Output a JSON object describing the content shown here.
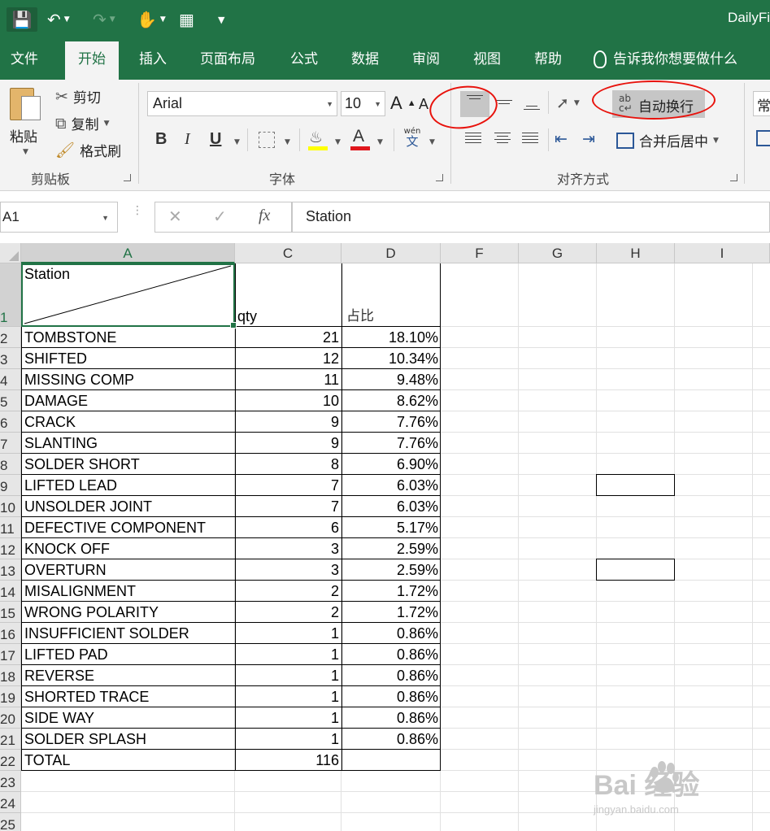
{
  "title_bar": {
    "app_title": "DailyFi"
  },
  "tabs": [
    {
      "id": "file",
      "label": "文件"
    },
    {
      "id": "home",
      "label": "开始",
      "active": true
    },
    {
      "id": "insert",
      "label": "插入"
    },
    {
      "id": "layout",
      "label": "页面布局"
    },
    {
      "id": "formulas",
      "label": "公式"
    },
    {
      "id": "data",
      "label": "数据"
    },
    {
      "id": "review",
      "label": "审阅"
    },
    {
      "id": "view",
      "label": "视图"
    },
    {
      "id": "help",
      "label": "帮助"
    }
  ],
  "tell_me": {
    "label": "告诉我你想要做什么"
  },
  "ribbon": {
    "clipboard": {
      "paste": "粘贴",
      "cut": "剪切",
      "copy": "复制",
      "painter": "格式刷",
      "group": "剪贴板"
    },
    "font": {
      "name": "Arial",
      "size": "10",
      "bold": "B",
      "italic": "I",
      "underline": "U",
      "phonetic": "wén",
      "phonetic_char": "文",
      "group": "字体"
    },
    "alignment": {
      "wrap": "自动换行",
      "merge": "合并后居中",
      "group": "对齐方式"
    },
    "number": {
      "format": "常"
    }
  },
  "formula_bar": {
    "name_box": "A1",
    "fx": "fx",
    "content": "Station"
  },
  "columns": [
    "A",
    "C",
    "D",
    "F",
    "G",
    "H",
    "I"
  ],
  "header_row": {
    "station": "Station",
    "qty": "qty",
    "ratio": "占比"
  },
  "rows": [
    {
      "n": "1"
    },
    {
      "n": "2",
      "a": "TOMBSTONE",
      "c": "21",
      "d": "18.10%"
    },
    {
      "n": "3",
      "a": "SHIFTED",
      "c": "12",
      "d": "10.34%"
    },
    {
      "n": "4",
      "a": "MISSING COMP",
      "c": "11",
      "d": "9.48%"
    },
    {
      "n": "5",
      "a": "DAMAGE",
      "c": "10",
      "d": "8.62%"
    },
    {
      "n": "6",
      "a": "CRACK",
      "c": "9",
      "d": "7.76%"
    },
    {
      "n": "7",
      "a": "SLANTING",
      "c": "9",
      "d": "7.76%"
    },
    {
      "n": "8",
      "a": "SOLDER SHORT",
      "c": "8",
      "d": "6.90%"
    },
    {
      "n": "9",
      "a": "LIFTED LEAD",
      "c": "7",
      "d": "6.03%"
    },
    {
      "n": "10",
      "a": "UNSOLDER JOINT",
      "c": "7",
      "d": "6.03%"
    },
    {
      "n": "11",
      "a": "DEFECTIVE COMPONENT",
      "c": "6",
      "d": "5.17%"
    },
    {
      "n": "12",
      "a": "KNOCK OFF",
      "c": "3",
      "d": "2.59%"
    },
    {
      "n": "13",
      "a": "OVERTURN",
      "c": "3",
      "d": "2.59%"
    },
    {
      "n": "14",
      "a": "MISALIGNMENT",
      "c": "2",
      "d": "1.72%"
    },
    {
      "n": "15",
      "a": "WRONG POLARITY",
      "c": "2",
      "d": "1.72%"
    },
    {
      "n": "16",
      "a": "INSUFFICIENT SOLDER",
      "c": "1",
      "d": "0.86%"
    },
    {
      "n": "17",
      "a": "LIFTED PAD",
      "c": "1",
      "d": "0.86%"
    },
    {
      "n": "18",
      "a": "REVERSE",
      "c": "1",
      "d": "0.86%"
    },
    {
      "n": "19",
      "a": "SHORTED TRACE",
      "c": "1",
      "d": "0.86%"
    },
    {
      "n": "20",
      "a": "SIDE WAY",
      "c": "1",
      "d": "0.86%"
    },
    {
      "n": "21",
      "a": "SOLDER SPLASH",
      "c": "1",
      "d": "0.86%"
    },
    {
      "n": "22",
      "a": "TOTAL",
      "c": "116",
      "d": ""
    },
    {
      "n": "23"
    },
    {
      "n": "24"
    },
    {
      "n": "25"
    }
  ],
  "watermark": {
    "brand": "Bai  经验",
    "url": "jingyan.baidu.com"
  },
  "colors": {
    "excel_green": "#217346",
    "annotation_red": "#e8120c"
  }
}
